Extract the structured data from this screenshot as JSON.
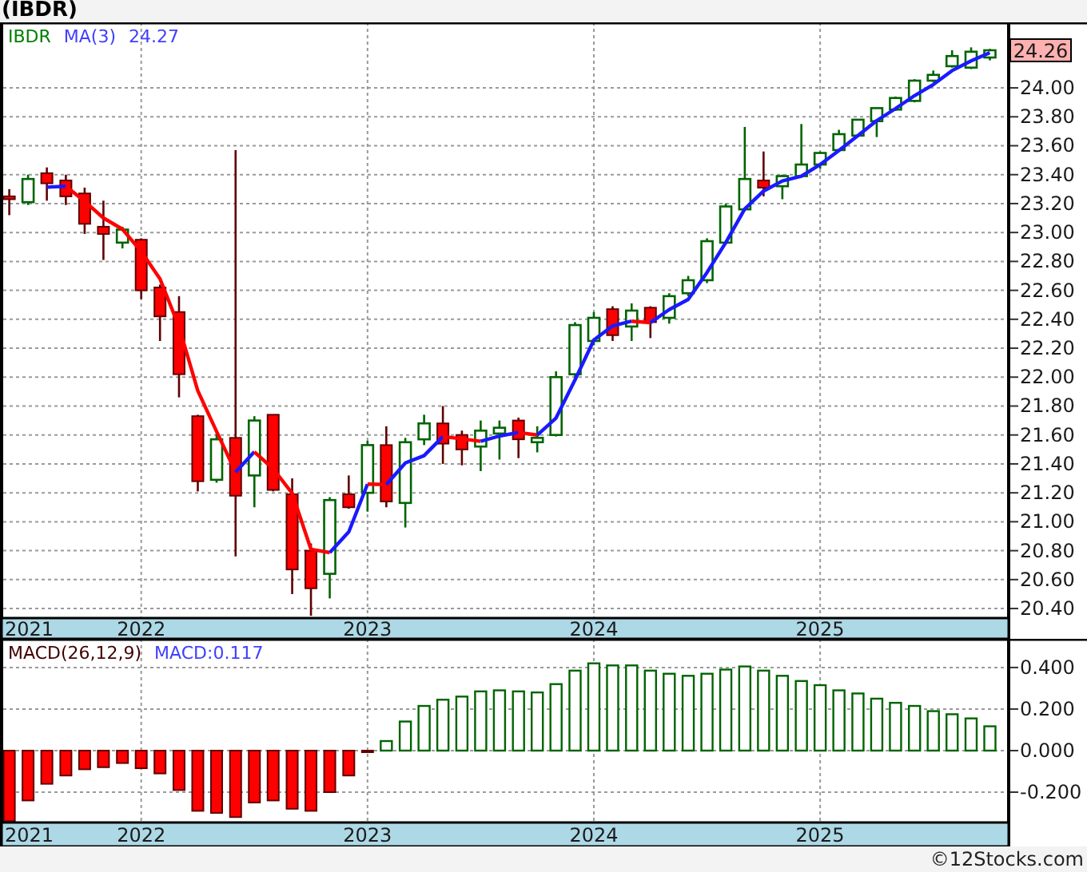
{
  "title": "(IBDR)",
  "price_chart": {
    "legend": [
      {
        "kind": "text",
        "text": "IBDR",
        "color": "#008000"
      },
      {
        "kind": "text",
        "text": "MA(3)",
        "color": "#4040ff"
      },
      {
        "kind": "text",
        "text": "24.27",
        "color": "#4040ff"
      }
    ],
    "last_price": "24.26",
    "date_axis_start": "2021",
    "chart_data": {
      "type": "candlestick",
      "grid": true,
      "xlim": [
        2021.376,
        2025.833
      ],
      "ylim": [
        20.334,
        24.453
      ],
      "x": [
        2021.417,
        2021.5,
        2021.583,
        2021.667,
        2021.75,
        2021.833,
        2021.917,
        2022,
        2022.083,
        2022.167,
        2022.25,
        2022.333,
        2022.417,
        2022.5,
        2022.583,
        2022.667,
        2022.75,
        2022.833,
        2022.917,
        2023,
        2023.083,
        2023.167,
        2023.25,
        2023.333,
        2023.417,
        2023.5,
        2023.583,
        2023.667,
        2023.75,
        2023.833,
        2023.917,
        2024,
        2024.083,
        2024.167,
        2024.25,
        2024.333,
        2024.417,
        2024.5,
        2024.583,
        2024.667,
        2024.75,
        2024.833,
        2024.917,
        2025,
        2025.083,
        2025.167,
        2025.25,
        2025.333,
        2025.417,
        2025.5,
        2025.583,
        2025.667,
        2025.75
      ],
      "xticks": [
        {
          "value": 2022,
          "label": "2022"
        },
        {
          "value": 2023,
          "label": "2023"
        },
        {
          "value": 2024,
          "label": "2024"
        },
        {
          "value": 2025,
          "label": "2025"
        }
      ],
      "yticks": [
        {
          "value": 24.0,
          "label": "24.00"
        },
        {
          "value": 23.8,
          "label": "23.80"
        },
        {
          "value": 23.6,
          "label": "23.60"
        },
        {
          "value": 23.4,
          "label": "23.40"
        },
        {
          "value": 23.2,
          "label": "23.20"
        },
        {
          "value": 23.0,
          "label": "23.00"
        },
        {
          "value": 22.8,
          "label": "22.80"
        },
        {
          "value": 22.6,
          "label": "22.60"
        },
        {
          "value": 22.4,
          "label": "22.40"
        },
        {
          "value": 22.2,
          "label": "22.20"
        },
        {
          "value": 22.0,
          "label": "22.00"
        },
        {
          "value": 21.8,
          "label": "21.80"
        },
        {
          "value": 21.6,
          "label": "21.60"
        },
        {
          "value": 21.4,
          "label": "21.40"
        },
        {
          "value": 21.2,
          "label": "21.20"
        },
        {
          "value": 21.0,
          "label": "21.00"
        },
        {
          "value": 20.8,
          "label": "20.80"
        },
        {
          "value": 20.6,
          "label": "20.60"
        },
        {
          "value": 20.4,
          "label": "20.40"
        }
      ],
      "ohlc": [
        [
          23.25,
          23.3,
          23.12,
          23.23
        ],
        [
          23.21,
          23.4,
          23.19,
          23.37
        ],
        [
          23.41,
          23.45,
          23.22,
          23.34
        ],
        [
          23.36,
          23.4,
          23.19,
          23.25
        ],
        [
          23.27,
          23.31,
          22.99,
          23.06
        ],
        [
          23.04,
          23.22,
          22.81,
          22.99
        ],
        [
          22.93,
          23.04,
          22.89,
          23.02
        ],
        [
          22.95,
          22.96,
          22.54,
          22.6
        ],
        [
          22.62,
          22.64,
          22.25,
          22.42
        ],
        [
          22.45,
          22.56,
          21.86,
          22.02
        ],
        [
          21.73,
          21.74,
          21.21,
          21.28
        ],
        [
          21.29,
          21.61,
          21.27,
          21.57
        ],
        [
          21.58,
          23.57,
          20.76,
          21.18
        ],
        [
          21.32,
          21.73,
          21.1,
          21.7
        ],
        [
          21.74,
          21.74,
          21.21,
          21.22
        ],
        [
          21.19,
          21.3,
          20.5,
          20.67
        ],
        [
          20.8,
          20.85,
          20.35,
          20.54
        ],
        [
          20.64,
          21.17,
          20.47,
          21.15
        ],
        [
          21.19,
          21.32,
          21.09,
          21.1
        ],
        [
          21.2,
          21.56,
          21.07,
          21.53
        ],
        [
          21.53,
          21.66,
          21.1,
          21.14
        ],
        [
          21.13,
          21.58,
          20.96,
          21.55
        ],
        [
          21.57,
          21.74,
          21.53,
          21.68
        ],
        [
          21.68,
          21.8,
          21.4,
          21.54
        ],
        [
          21.6,
          21.63,
          21.39,
          21.5
        ],
        [
          21.52,
          21.7,
          21.35,
          21.63
        ],
        [
          21.61,
          21.7,
          21.43,
          21.65
        ],
        [
          21.7,
          21.72,
          21.44,
          21.57
        ],
        [
          21.55,
          21.66,
          21.48,
          21.58
        ],
        [
          21.6,
          22.04,
          21.59,
          22.0
        ],
        [
          22.02,
          22.38,
          21.98,
          22.36
        ],
        [
          22.25,
          22.45,
          22.22,
          22.41
        ],
        [
          22.47,
          22.49,
          22.25,
          22.29
        ],
        [
          22.35,
          22.51,
          22.25,
          22.46
        ],
        [
          22.48,
          22.49,
          22.27,
          22.38
        ],
        [
          22.41,
          22.58,
          22.37,
          22.56
        ],
        [
          22.58,
          22.7,
          22.56,
          22.67
        ],
        [
          22.67,
          22.96,
          22.65,
          22.94
        ],
        [
          22.93,
          23.2,
          22.92,
          23.18
        ],
        [
          23.16,
          23.73,
          23.15,
          23.37
        ],
        [
          23.36,
          23.56,
          23.25,
          23.31
        ],
        [
          23.32,
          23.4,
          23.23,
          23.39
        ],
        [
          23.39,
          23.75,
          23.38,
          23.47
        ],
        [
          23.47,
          23.56,
          23.44,
          23.55
        ],
        [
          23.57,
          23.71,
          23.56,
          23.68
        ],
        [
          23.67,
          23.78,
          23.66,
          23.78
        ],
        [
          23.77,
          23.86,
          23.66,
          23.86
        ],
        [
          23.85,
          23.94,
          23.84,
          23.93
        ],
        [
          23.91,
          24.06,
          23.9,
          24.05
        ],
        [
          24.05,
          24.12,
          24.04,
          24.09
        ],
        [
          24.15,
          24.26,
          24.14,
          24.22
        ],
        [
          24.14,
          24.28,
          24.13,
          24.25
        ],
        [
          24.21,
          24.27,
          24.19,
          24.26
        ]
      ]
    }
  },
  "macd_chart": {
    "legend": [
      {
        "kind": "text",
        "text": "MACD(26,12,9)",
        "color": "#400000"
      },
      {
        "kind": "text",
        "text": "MACD:0.117",
        "color": "#4040ff"
      }
    ],
    "date_axis_start": "2021",
    "chart_data": {
      "type": "bar",
      "grid": true,
      "xlim": [
        2021.376,
        2025.833
      ],
      "ylim": [
        -0.346,
        0.538
      ],
      "x": [
        2021.417,
        2021.5,
        2021.583,
        2021.667,
        2021.75,
        2021.833,
        2021.917,
        2022,
        2022.083,
        2022.167,
        2022.25,
        2022.333,
        2022.417,
        2022.5,
        2022.583,
        2022.667,
        2022.75,
        2022.833,
        2022.917,
        2023,
        2023.083,
        2023.167,
        2023.25,
        2023.333,
        2023.417,
        2023.5,
        2023.583,
        2023.667,
        2023.75,
        2023.833,
        2023.917,
        2024,
        2024.083,
        2024.167,
        2024.25,
        2024.333,
        2024.417,
        2024.5,
        2024.583,
        2024.667,
        2024.75,
        2024.833,
        2024.917,
        2025,
        2025.083,
        2025.167,
        2025.25,
        2025.333,
        2025.417,
        2025.5,
        2025.583,
        2025.667,
        2025.75
      ],
      "xticks": [
        {
          "value": 2022,
          "label": "2022"
        },
        {
          "value": 2023,
          "label": "2023"
        },
        {
          "value": 2024,
          "label": "2024"
        },
        {
          "value": 2025,
          "label": "2025"
        }
      ],
      "yticks": [
        {
          "value": 0.4,
          "label": "0.400"
        },
        {
          "value": 0.2,
          "label": "0.200"
        },
        {
          "value": 0.0,
          "label": "0.000"
        },
        {
          "value": -0.2,
          "label": "-0.200"
        }
      ],
      "values": [
        -0.34,
        -0.24,
        -0.16,
        -0.12,
        -0.09,
        -0.08,
        -0.06,
        -0.085,
        -0.11,
        -0.19,
        -0.29,
        -0.3,
        -0.32,
        -0.25,
        -0.24,
        -0.28,
        -0.29,
        -0.2,
        -0.12,
        -0.005,
        0.046,
        0.14,
        0.215,
        0.245,
        0.26,
        0.285,
        0.29,
        0.285,
        0.28,
        0.32,
        0.385,
        0.42,
        0.41,
        0.41,
        0.385,
        0.37,
        0.36,
        0.37,
        0.39,
        0.405,
        0.385,
        0.36,
        0.335,
        0.315,
        0.29,
        0.275,
        0.25,
        0.23,
        0.215,
        0.19,
        0.175,
        0.155,
        0.117
      ]
    }
  },
  "footer": "©12Stocks.com"
}
